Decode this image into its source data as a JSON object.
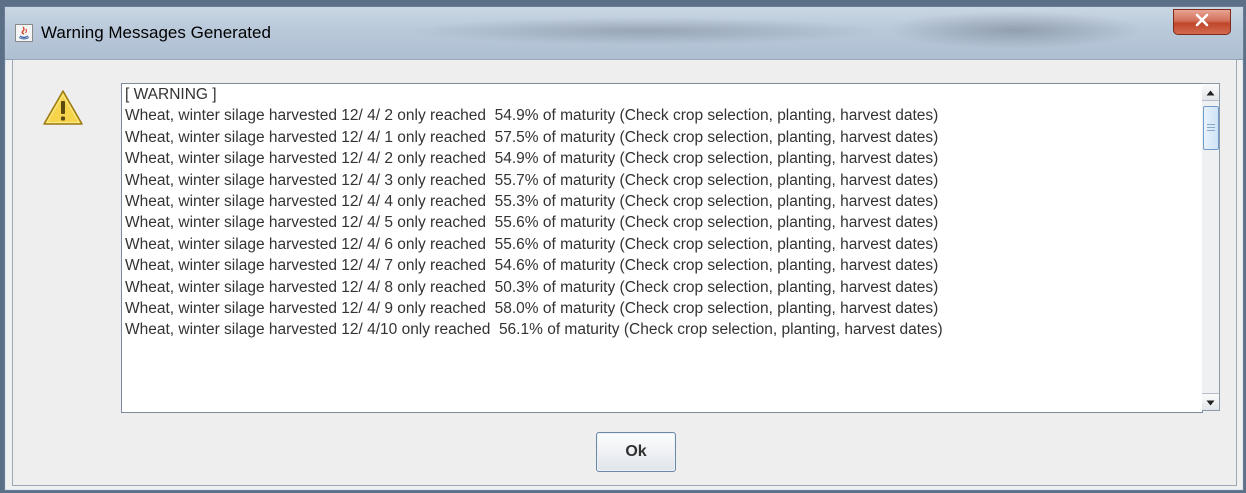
{
  "window": {
    "title": "Warning Messages Generated",
    "close_label": "x"
  },
  "dialog": {
    "icon": "warning-triangle-icon",
    "lines": [
      "[ WARNING ]",
      "Wheat, winter silage harvested 12/ 4/ 2 only reached  54.9% of maturity (Check crop selection, planting, harvest dates)",
      "Wheat, winter silage harvested 12/ 4/ 1 only reached  57.5% of maturity (Check crop selection, planting, harvest dates)",
      "Wheat, winter silage harvested 12/ 4/ 2 only reached  54.9% of maturity (Check crop selection, planting, harvest dates)",
      "Wheat, winter silage harvested 12/ 4/ 3 only reached  55.7% of maturity (Check crop selection, planting, harvest dates)",
      "Wheat, winter silage harvested 12/ 4/ 4 only reached  55.3% of maturity (Check crop selection, planting, harvest dates)",
      "Wheat, winter silage harvested 12/ 4/ 5 only reached  55.6% of maturity (Check crop selection, planting, harvest dates)",
      "Wheat, winter silage harvested 12/ 4/ 6 only reached  55.6% of maturity (Check crop selection, planting, harvest dates)",
      "Wheat, winter silage harvested 12/ 4/ 7 only reached  54.6% of maturity (Check crop selection, planting, harvest dates)",
      "Wheat, winter silage harvested 12/ 4/ 8 only reached  50.3% of maturity (Check crop selection, planting, harvest dates)",
      "Wheat, winter silage harvested 12/ 4/ 9 only reached  58.0% of maturity (Check crop selection, planting, harvest dates)",
      "Wheat, winter silage harvested 12/ 4/10 only reached  56.1% of maturity (Check crop selection, planting, harvest dates)"
    ],
    "ok_label": "Ok"
  },
  "colors": {
    "close_button": "#c9462c",
    "warning_fill": "#f5d34a",
    "title_bar": "#bccbdb"
  }
}
